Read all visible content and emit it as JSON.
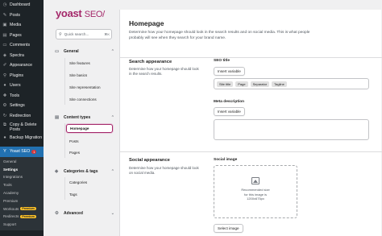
{
  "wp_menu": {
    "items": [
      {
        "label": "Dashboard",
        "icon": "dashboard-icon",
        "glyph": "◷"
      },
      {
        "label": "Posts",
        "icon": "posts-icon",
        "glyph": "✎"
      },
      {
        "label": "Media",
        "icon": "media-icon",
        "glyph": "▣"
      },
      {
        "label": "Pages",
        "icon": "pages-icon",
        "glyph": "▤"
      },
      {
        "label": "Comments",
        "icon": "comments-icon",
        "glyph": "▭"
      },
      {
        "label": "Spectra",
        "icon": "spectra-icon",
        "glyph": "◈"
      },
      {
        "label": "Appearance",
        "icon": "appearance-icon",
        "glyph": "✐"
      },
      {
        "label": "Plugins",
        "icon": "plugins-icon",
        "glyph": "⚲"
      },
      {
        "label": "Users",
        "icon": "users-icon",
        "glyph": "●"
      },
      {
        "label": "Tools",
        "icon": "tools-icon",
        "glyph": "✚"
      },
      {
        "label": "Settings",
        "icon": "settings-icon",
        "glyph": "⚙"
      },
      {
        "label": "Redirection",
        "icon": "redirection-icon",
        "glyph": "↻"
      },
      {
        "label": "Copy & Delete Posts",
        "icon": "copy-delete-icon",
        "glyph": "⧉"
      },
      {
        "label": "Backup Migration",
        "icon": "backup-icon",
        "glyph": "●"
      }
    ],
    "yoast": {
      "label": "Yoast SEO",
      "badge": "1",
      "icon": "yoast-icon",
      "glyph": "Y"
    },
    "submenu": [
      {
        "label": "General"
      },
      {
        "label": "Settings",
        "active": true
      },
      {
        "label": "Integrations"
      },
      {
        "label": "Tools"
      },
      {
        "label": "Academy"
      },
      {
        "label": "Premium"
      },
      {
        "label": "Workouts",
        "premium": "Premium"
      },
      {
        "label": "Redirects",
        "premium": "Premium"
      },
      {
        "label": "Support"
      }
    ]
  },
  "yoast_nav": {
    "logo_main": "yoast",
    "logo_seo": "SEO",
    "logo_slash": "/",
    "search_placeholder": "Quick search...",
    "search_shortcut": "⌘K",
    "sections": [
      {
        "label": "General",
        "links": [
          "Site features",
          "Site basics",
          "Site representation",
          "Site connections"
        ]
      },
      {
        "label": "Content types",
        "links": [
          "Homepage",
          "Posts",
          "Pages"
        ],
        "active": "Homepage"
      },
      {
        "label": "Categories & tags",
        "links": [
          "Categories",
          "Tags"
        ]
      },
      {
        "label": "Advanced",
        "links": []
      }
    ]
  },
  "main": {
    "title": "Homepage",
    "description": "Determine how your homepage should look in the search results and on social media. This is what people probably will see when they search for your brand name.",
    "search_appearance": {
      "title": "Search appearance",
      "description": "Determine how your homepage should look in the search results.",
      "seo_title_label": "SEO title",
      "insert_variable": "Insert variable",
      "chips": [
        "Site title",
        "Page",
        "Separator",
        "Tagline"
      ],
      "meta_label": "Meta description",
      "meta_insert_variable": "Insert variable"
    },
    "social_appearance": {
      "title": "Social appearance",
      "description": "Determine how your homepage should look on social media.",
      "image_label": "Social image",
      "image_hint": "Recommended size\nfor this image is\n1200x675px",
      "select_image": "Select image"
    }
  }
}
